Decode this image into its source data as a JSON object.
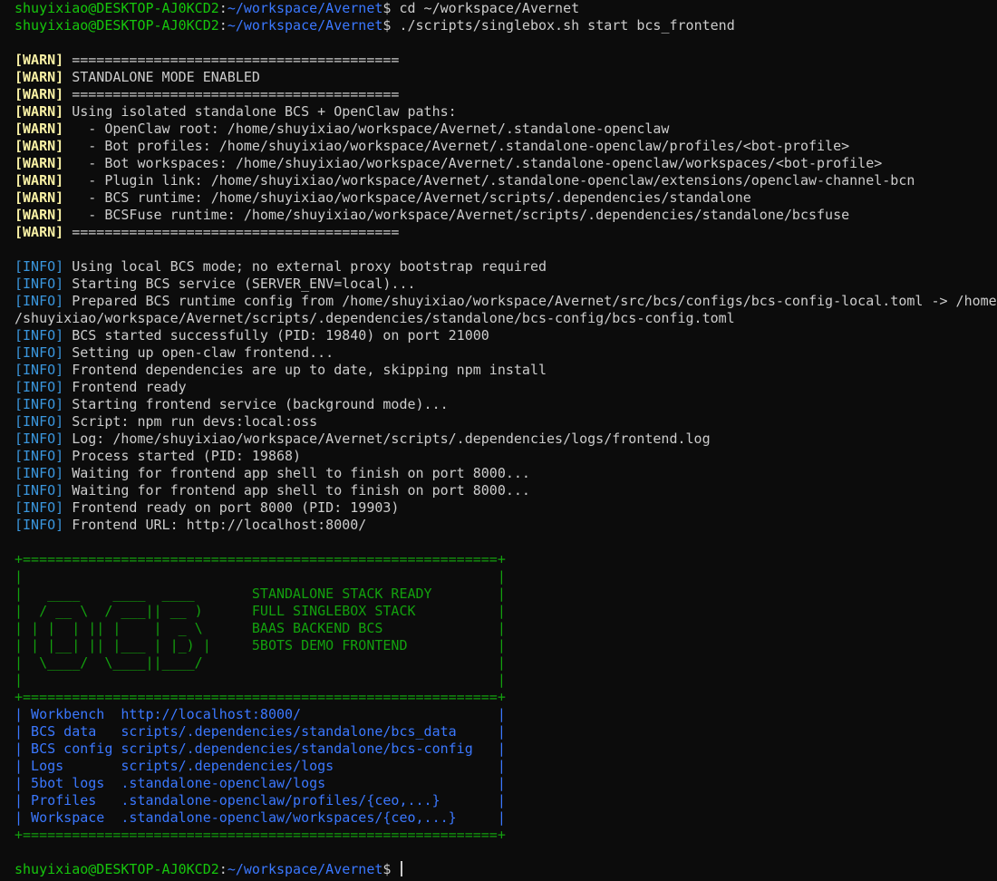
{
  "prompt": {
    "userhost": "shuyixiao@DESKTOP-AJ0KCD2",
    "sep": ":",
    "path": "~/workspace/Avernet",
    "symbol": "$ "
  },
  "commands": [
    "cd ~/workspace/Avernet",
    "./scripts/singlebox.sh start bcs_frontend"
  ],
  "warn_tag": "[WARN]",
  "warn_lines": [
    " ========================================",
    " STANDALONE MODE ENABLED",
    " ========================================",
    " Using isolated standalone BCS + OpenClaw paths:",
    "   - OpenClaw root: /home/shuyixiao/workspace/Avernet/.standalone-openclaw",
    "   - Bot profiles: /home/shuyixiao/workspace/Avernet/.standalone-openclaw/profiles/<bot-profile>",
    "   - Bot workspaces: /home/shuyixiao/workspace/Avernet/.standalone-openclaw/workspaces/<bot-profile>",
    "   - Plugin link: /home/shuyixiao/workspace/Avernet/.standalone-openclaw/extensions/openclaw-channel-bcn",
    "   - BCS runtime: /home/shuyixiao/workspace/Avernet/scripts/.dependencies/standalone",
    "   - BCSFuse runtime: /home/shuyixiao/workspace/Avernet/scripts/.dependencies/standalone/bcsfuse",
    " ========================================"
  ],
  "info_tag": "[INFO]",
  "info_lines": [
    " Using local BCS mode; no external proxy bootstrap required",
    " Starting BCS service (SERVER_ENV=local)...",
    " Prepared BCS runtime config from /home/shuyixiao/workspace/Avernet/src/bcs/configs/bcs-config-local.toml -> /home",
    "/shuyixiao/workspace/Avernet/scripts/.dependencies/standalone/bcs-config/bcs-config.toml",
    " BCS started successfully (PID: 19840) on port 21000",
    " Setting up open-claw frontend...",
    " Frontend dependencies are up to date, skipping npm install",
    " Frontend ready",
    " Starting frontend service (background mode)...",
    " Script: npm run devs:local:oss",
    " Log: /home/shuyixiao/workspace/Avernet/scripts/.dependencies/logs/frontend.log",
    " Process started (PID: 19868)",
    " Waiting for frontend app shell to finish on port 8000...",
    " Waiting for frontend app shell to finish on port 8000...",
    " Frontend ready on port 8000 (PID: 19903)",
    " Frontend URL: http://localhost:8000/"
  ],
  "banner": {
    "lines": [
      "+==========================================================+",
      "|                                                          |",
      "|   ____    ____  ____       STANDALONE STACK READY        |",
      "|  / __ \\  / ___|| __ )      FULL SINGLEBOX STACK          |",
      "| | |  | || |    |  _ \\      BAAS BACKEND BCS              |",
      "| | |__| || |___ | |_) |     5BOTS DEMO FRONTEND           |",
      "|  \\____/  \\____||____/                                    |",
      "|                                                          |",
      "+==========================================================+"
    ]
  },
  "table": {
    "rows": [
      "| Workbench  http://localhost:8000/                        |",
      "| BCS data   scripts/.dependencies/standalone/bcs_data     |",
      "| BCS config scripts/.dependencies/standalone/bcs-config   |",
      "| Logs       scripts/.dependencies/logs                    |",
      "| 5bot logs  .standalone-openclaw/logs                     |",
      "| Profiles   .standalone-openclaw/profiles/{ceo,...}       |",
      "| Workspace  .standalone-openclaw/workspaces/{ceo,...}     |"
    ],
    "bottom": "+==========================================================+"
  }
}
